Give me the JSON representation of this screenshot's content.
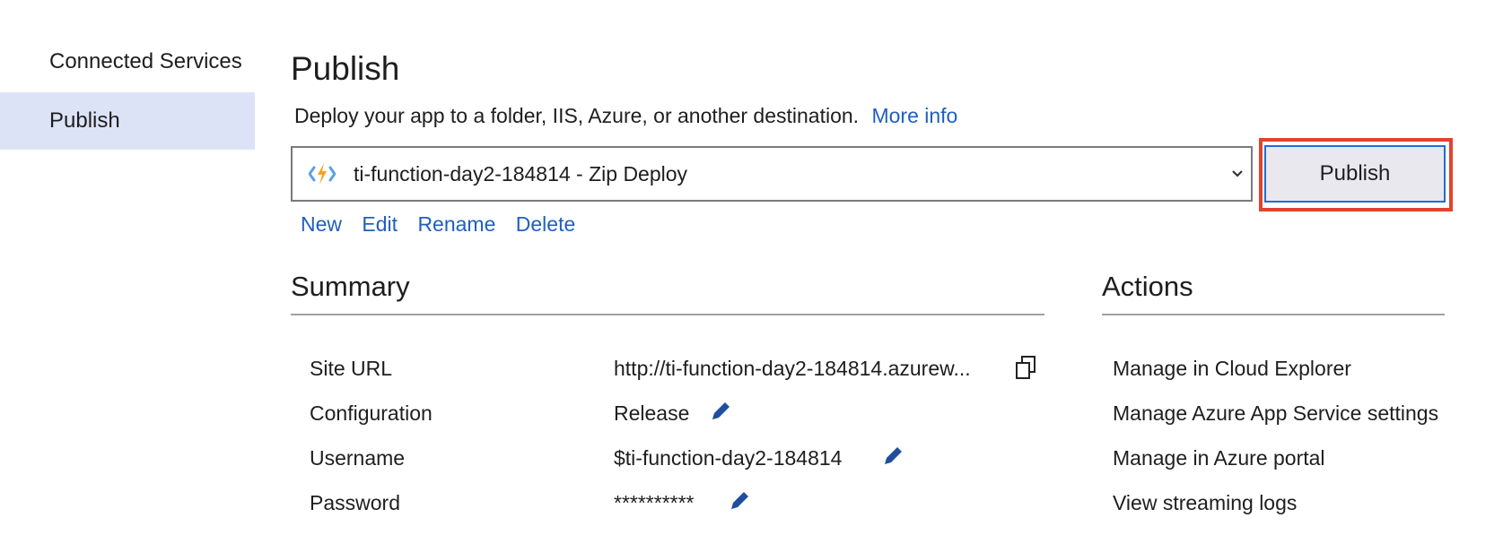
{
  "sidebar": {
    "items": [
      {
        "label": "Connected Services",
        "selected": false
      },
      {
        "label": "Publish",
        "selected": true
      }
    ]
  },
  "header": {
    "title": "Publish",
    "description": "Deploy your app to a folder, IIS, Azure, or another destination.",
    "more_info": "More info"
  },
  "profile": {
    "selected": "ti-function-day2-184814 - Zip Deploy",
    "icon": "azure-functions-icon",
    "actions": [
      "New",
      "Edit",
      "Rename",
      "Delete"
    ]
  },
  "publish_button": "Publish",
  "summary": {
    "title": "Summary",
    "rows": [
      {
        "label": "Site URL",
        "value": "http://ti-function-day2-184814.azurew...",
        "icon": "copy-icon"
      },
      {
        "label": "Configuration",
        "value": "Release",
        "icon": "pencil-icon"
      },
      {
        "label": "Username",
        "value": "$ti-function-day2-184814",
        "icon": "pencil-icon"
      },
      {
        "label": "Password",
        "value": "**********",
        "icon": "pencil-icon"
      }
    ]
  },
  "actions": {
    "title": "Actions",
    "links": [
      "Manage in Cloud Explorer",
      "Manage Azure App Service settings",
      "Manage in Azure portal",
      "View streaming logs"
    ]
  },
  "colors": {
    "link": "#1f5fbf",
    "selected_bg": "#dde3f7",
    "highlight_border": "#e1442b"
  }
}
